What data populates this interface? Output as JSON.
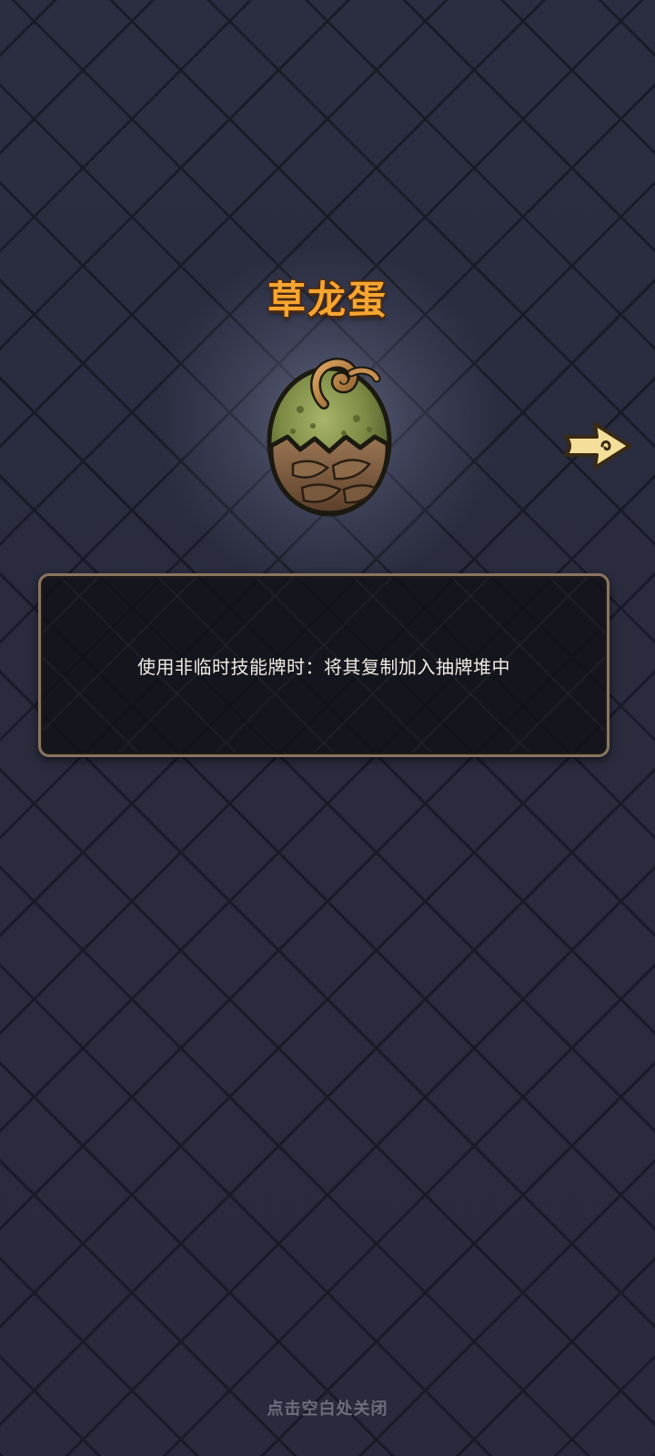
{
  "item": {
    "title": "草龙蛋",
    "icon": "grass-dragon-egg-icon",
    "description": "使用非临时技能牌时：将其复制加入抽牌堆中"
  },
  "navigation": {
    "next_icon": "next-arrow-icon"
  },
  "footer": {
    "close_hint": "点击空白处关闭"
  },
  "colors": {
    "title": "#f7a531",
    "background": "#2a2c3e",
    "panel_border": "#8a7660"
  }
}
